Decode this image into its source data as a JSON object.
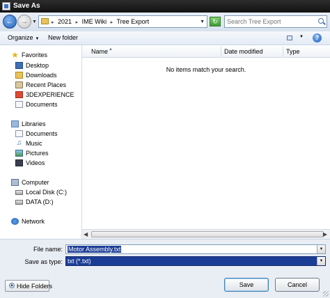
{
  "window": {
    "title": "Save As"
  },
  "address_bar": {
    "crumbs": [
      "2021",
      "IME Wiki",
      "Tree Export"
    ]
  },
  "search": {
    "placeholder": "Search Tree Export"
  },
  "toolbar": {
    "organize_label": "Organize",
    "new_folder_label": "New folder"
  },
  "nav": {
    "favorites": {
      "label": "Favorites",
      "items": [
        "Desktop",
        "Downloads",
        "Recent Places",
        "3DEXPERIENCE",
        "Documents"
      ]
    },
    "libraries": {
      "label": "Libraries",
      "items": [
        "Documents",
        "Music",
        "Pictures",
        "Videos"
      ]
    },
    "computer": {
      "label": "Computer",
      "items": [
        "Local Disk (C:)",
        "DATA (D:)"
      ]
    },
    "network": {
      "label": "Network"
    }
  },
  "file_list": {
    "columns": [
      "Name",
      "Date modified",
      "Type"
    ],
    "empty_message": "No items match your search."
  },
  "fields": {
    "file_name_label": "File name:",
    "file_name_value": "Motor Assembly.txt",
    "save_type_label": "Save as type:",
    "save_type_value": "txt (*.txt)"
  },
  "footer": {
    "hide_folders_label": "Hide Folders",
    "save_label": "Save",
    "cancel_label": "Cancel"
  },
  "colors": {
    "title_bar": "#1a1a1a",
    "selection": "#1c3d96",
    "folder": "#e8c35a"
  },
  "icons": [
    "app-icon",
    "back-arrow-icon",
    "forward-arrow-icon",
    "folder-icon",
    "refresh-icon",
    "search-icon",
    "view-icon",
    "help-icon",
    "star-icon",
    "desktop-icon",
    "folder-icon",
    "library-icon",
    "music-icon",
    "pictures-icon",
    "video-icon",
    "computer-icon",
    "disk-icon",
    "network-icon",
    "chevron-down-icon",
    "chevron-up-icon"
  ]
}
